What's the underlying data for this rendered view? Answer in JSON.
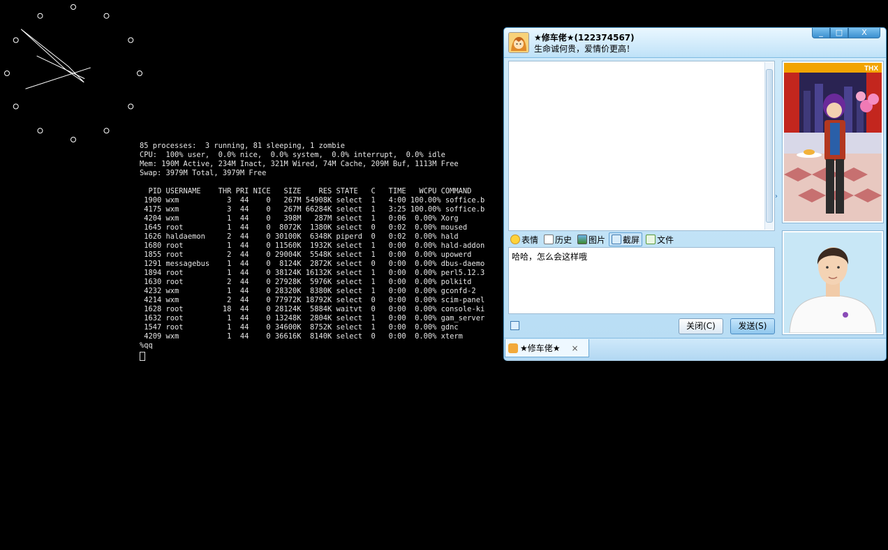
{
  "clock": {
    "hour": 9,
    "minute": 51,
    "second": 42
  },
  "terminal": {
    "lines": [
      "85 processes:  3 running, 81 sleeping, 1 zombie",
      "CPU:  100% user,  0.0% nice,  0.0% system,  0.0% interrupt,  0.0% idle",
      "Mem: 190M Active, 234M Inact, 321M Wired, 74M Cache, 209M Buf, 1113M Free",
      "Swap: 3979M Total, 3979M Free",
      "",
      "  PID USERNAME    THR PRI NICE   SIZE    RES STATE   C   TIME   WCPU COMMAND",
      " 1900 wxm           3  44    0   267M 54908K select  1   4:00 100.00% soffice.b",
      " 4175 wxm           3  44    0   267M 66284K select  1   3:25 100.00% soffice.b",
      " 4204 wxm           1  44    0   398M   287M select  1   0:06  0.00% Xorg",
      " 1645 root          1  44    0  8072K  1380K select  0   0:02  0.00% moused",
      " 1626 haldaemon     2  44    0 30100K  6348K piperd  0   0:02  0.00% hald",
      " 1680 root          1  44    0 11560K  1932K select  1   0:00  0.00% hald-addon",
      " 1855 root          2  44    0 29004K  5548K select  1   0:00  0.00% upowerd",
      " 1291 messagebus    1  44    0  8124K  2872K select  0   0:00  0.00% dbus-daemo",
      " 1894 root          1  44    0 38124K 16132K select  1   0:00  0.00% perl5.12.3",
      " 1630 root          2  44    0 27928K  5976K select  1   0:00  0.00% polkitd",
      " 4232 wxm           1  44    0 28320K  8380K select  1   0:00  0.00% gconfd-2",
      " 4214 wxm           2  44    0 77972K 18792K select  0   0:00  0.00% scim-panel",
      " 1628 root         18  44    0 28124K  5884K waitvt  0   0:00  0.00% console-ki",
      " 1632 root          1  44    0 13248K  2804K select  1   0:00  0.00% gam_server",
      " 1547 root          1  44    0 34600K  8752K select  1   0:00  0.00% gdnc",
      " 4209 wxm           1  44    0 36616K  8140K select  0   0:00  0.00% xterm",
      "%qq"
    ]
  },
  "chat": {
    "title": "★修车佬★(122374567)",
    "signature": "生命诚何贵，爱情价更高！",
    "window_buttons": {
      "minimize": "_",
      "maximize": "□",
      "close": "X"
    },
    "toolbar": [
      {
        "label": "表情",
        "icon": "smiley-icon"
      },
      {
        "label": "历史",
        "icon": "history-icon"
      },
      {
        "label": "图片",
        "icon": "image-icon"
      },
      {
        "label": "截屏",
        "icon": "screenshot-icon"
      },
      {
        "label": "文件",
        "icon": "file-icon"
      }
    ],
    "input_text": "哈哈，怎么会这样哦",
    "close_button": "关闭(C)",
    "send_button": "发送(S)",
    "tab_label": "★修车佬★",
    "tab_close": "×",
    "show_badge": "THX"
  }
}
